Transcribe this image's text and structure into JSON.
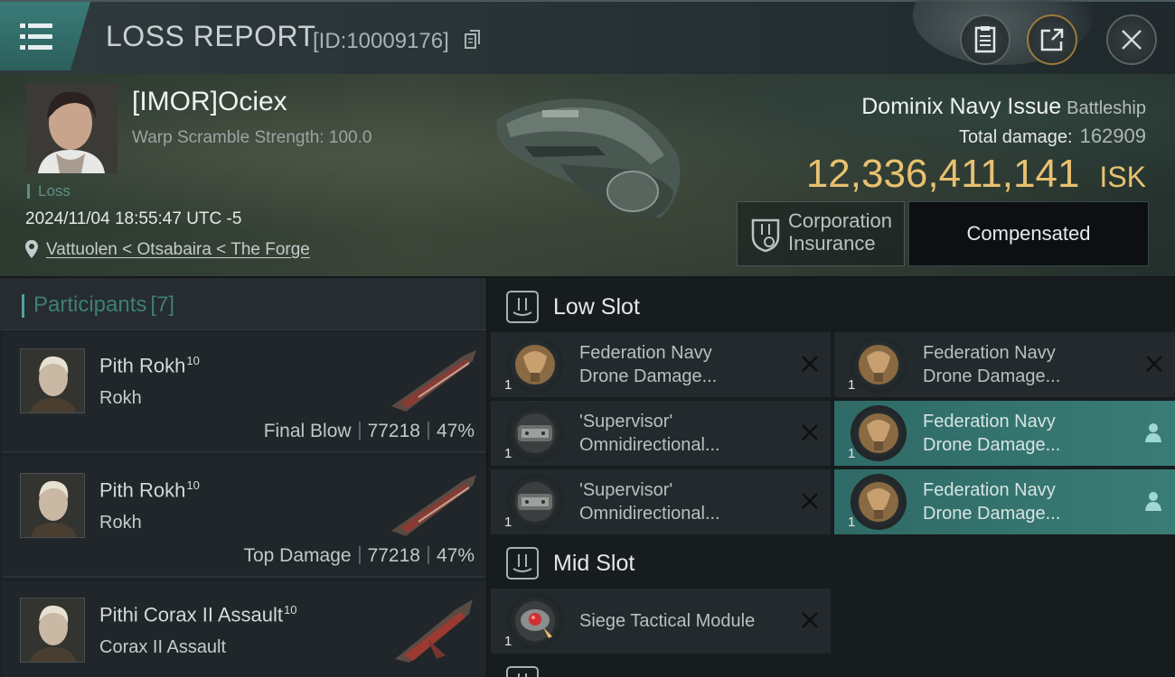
{
  "header": {
    "title": "LOSS REPORT",
    "report_id": "[ID:10009176]"
  },
  "victim": {
    "name": "[IMOR]Ociex",
    "warp_scramble": "Warp Scramble Strength: 100.0",
    "status": "Loss",
    "timestamp": "2024/11/04 18:55:47 UTC -5",
    "location": "Vattuolen < Otsabaira < The Forge",
    "ship_name": "Dominix Navy Issue",
    "ship_class": "Battleship",
    "total_damage_label": "Total damage:",
    "total_damage": "162909",
    "isk_value": "12,336,411,141",
    "isk_unit": "ISK",
    "insurance_label": "Corporation Insurance",
    "insurance_line1": "Corporation",
    "insurance_line2": "Insurance",
    "compensation": "Compensated"
  },
  "participants": {
    "title": "Participants",
    "count": "[7]",
    "rows": [
      {
        "name": "Pith Rokh",
        "level": "10",
        "ship": "Rokh",
        "tag": "Final Blow",
        "damage": "77218",
        "percent": "47%"
      },
      {
        "name": "Pith Rokh",
        "level": "10",
        "ship": "Rokh",
        "tag": "Top Damage",
        "damage": "77218",
        "percent": "47%"
      },
      {
        "name": "Pithi Corax II Assault",
        "level": "10",
        "ship": "Corax II Assault",
        "tag": "",
        "damage": "",
        "percent": ""
      }
    ]
  },
  "slots": {
    "low_label": "Low Slot",
    "mid_label": "Mid Slot",
    "low": [
      {
        "line1": "Federation Navy",
        "line2": "Drone Damage...",
        "qty": "1",
        "icon": "drone-damage-amplifier-icon",
        "state": "destroyed"
      },
      {
        "line1": "Federation Navy",
        "line2": "Drone Damage...",
        "qty": "1",
        "icon": "drone-damage-amplifier-icon",
        "state": "destroyed"
      },
      {
        "line1": "'Supervisor'",
        "line2": "Omnidirectional...",
        "qty": "1",
        "icon": "omnidirectional-link-icon",
        "state": "destroyed"
      },
      {
        "line1": "Federation Navy",
        "line2": "Drone Damage...",
        "qty": "1",
        "icon": "drone-damage-amplifier-icon",
        "state": "dropped"
      },
      {
        "line1": "'Supervisor'",
        "line2": "Omnidirectional...",
        "qty": "1",
        "icon": "omnidirectional-link-icon",
        "state": "destroyed"
      },
      {
        "line1": "Federation Navy",
        "line2": "Drone Damage...",
        "qty": "1",
        "icon": "drone-damage-amplifier-icon",
        "state": "dropped"
      }
    ],
    "mid": [
      {
        "line1": "Siege Tactical Module",
        "qty": "1",
        "icon": "siege-module-icon",
        "state": "destroyed"
      }
    ]
  },
  "colors": {
    "accent_teal": "#3a7c76",
    "isk_gold": "#e8c170",
    "highlight_row": "#2f6a66"
  }
}
